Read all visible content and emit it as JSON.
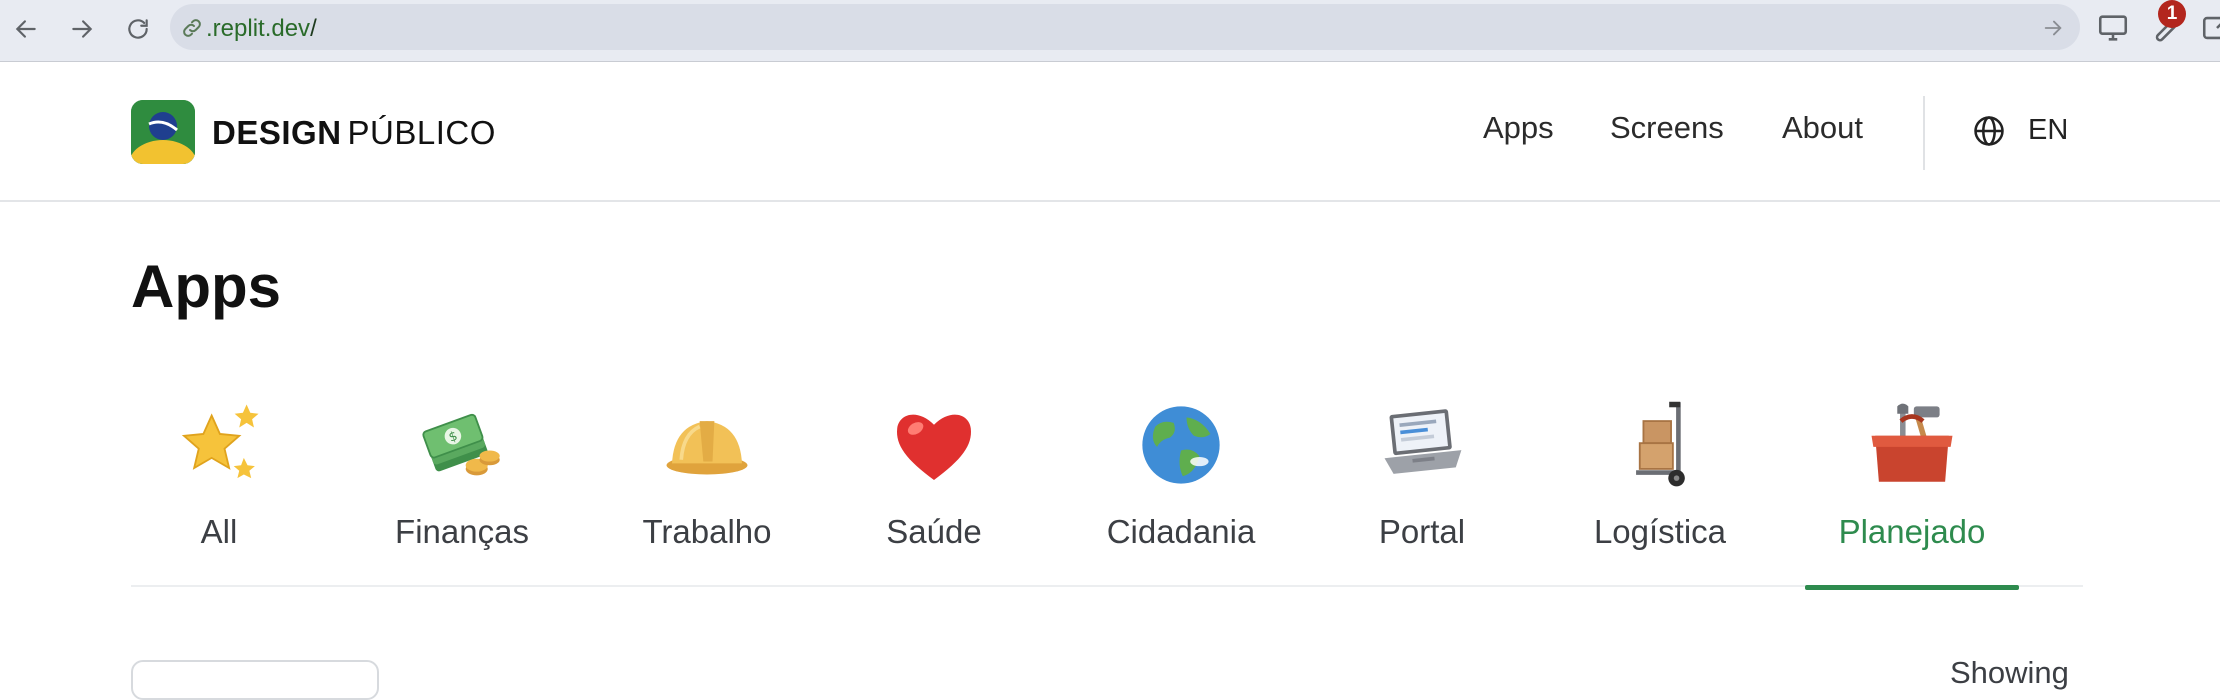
{
  "browser": {
    "url_host": ".replit.dev",
    "url_path": "/",
    "badge_count": "1"
  },
  "site": {
    "brand_bold": "DESIGN",
    "brand_regular": "PÚBLICO",
    "nav": {
      "apps": "Apps",
      "screens": "Screens",
      "about": "About"
    },
    "language": "EN"
  },
  "page": {
    "title": "Apps"
  },
  "categories": [
    {
      "label": "All",
      "icon": "stars-icon"
    },
    {
      "label": "Finanças",
      "icon": "money-icon"
    },
    {
      "label": "Trabalho",
      "icon": "hard-hat-icon"
    },
    {
      "label": "Saúde",
      "icon": "heart-icon"
    },
    {
      "label": "Cidadania",
      "icon": "globe-earth-icon"
    },
    {
      "label": "Portal",
      "icon": "laptop-icon"
    },
    {
      "label": "Logística",
      "icon": "hand-truck-icon"
    },
    {
      "label": "Planejado",
      "icon": "toolbox-icon",
      "active": true
    }
  ],
  "list": {
    "showing_label": "Showing"
  },
  "colors": {
    "accent": "#2e8b4e",
    "badge": "#b3261e"
  }
}
